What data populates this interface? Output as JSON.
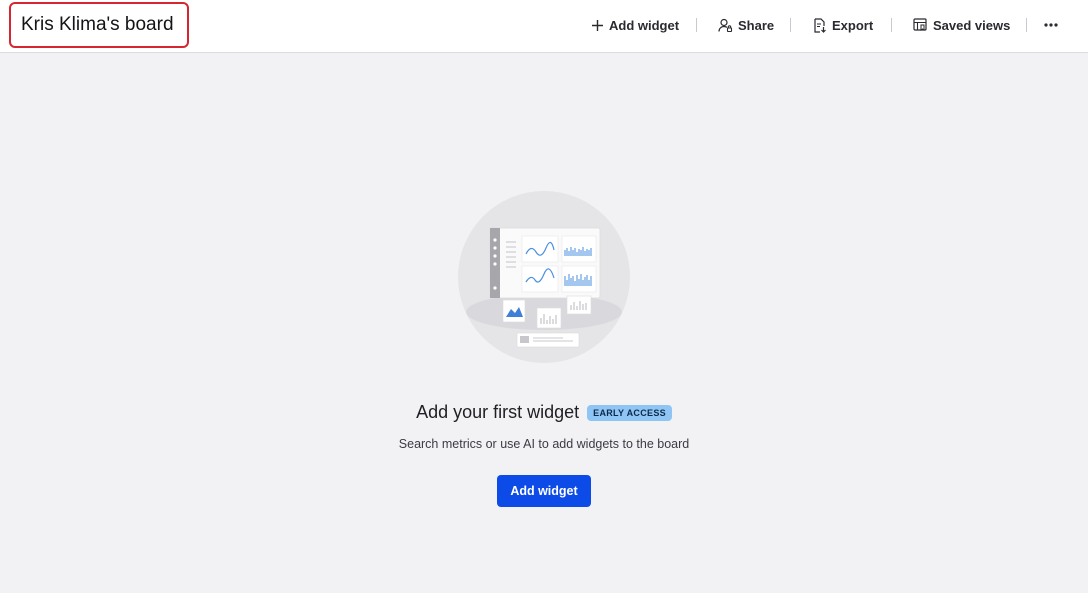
{
  "header": {
    "board_title": "Kris Klima's board"
  },
  "toolbar": {
    "add_widget": "Add widget",
    "share": "Share",
    "export": "Export",
    "saved_views": "Saved views"
  },
  "empty_state": {
    "title": "Add your first widget",
    "badge": "EARLY ACCESS",
    "subtitle": "Search metrics or use AI to add widgets to the board",
    "button": "Add widget"
  },
  "colors": {
    "primary": "#0d4be8",
    "badge": "#8ec5f5",
    "highlight": "#d6262f",
    "background": "#f2f2f5"
  }
}
